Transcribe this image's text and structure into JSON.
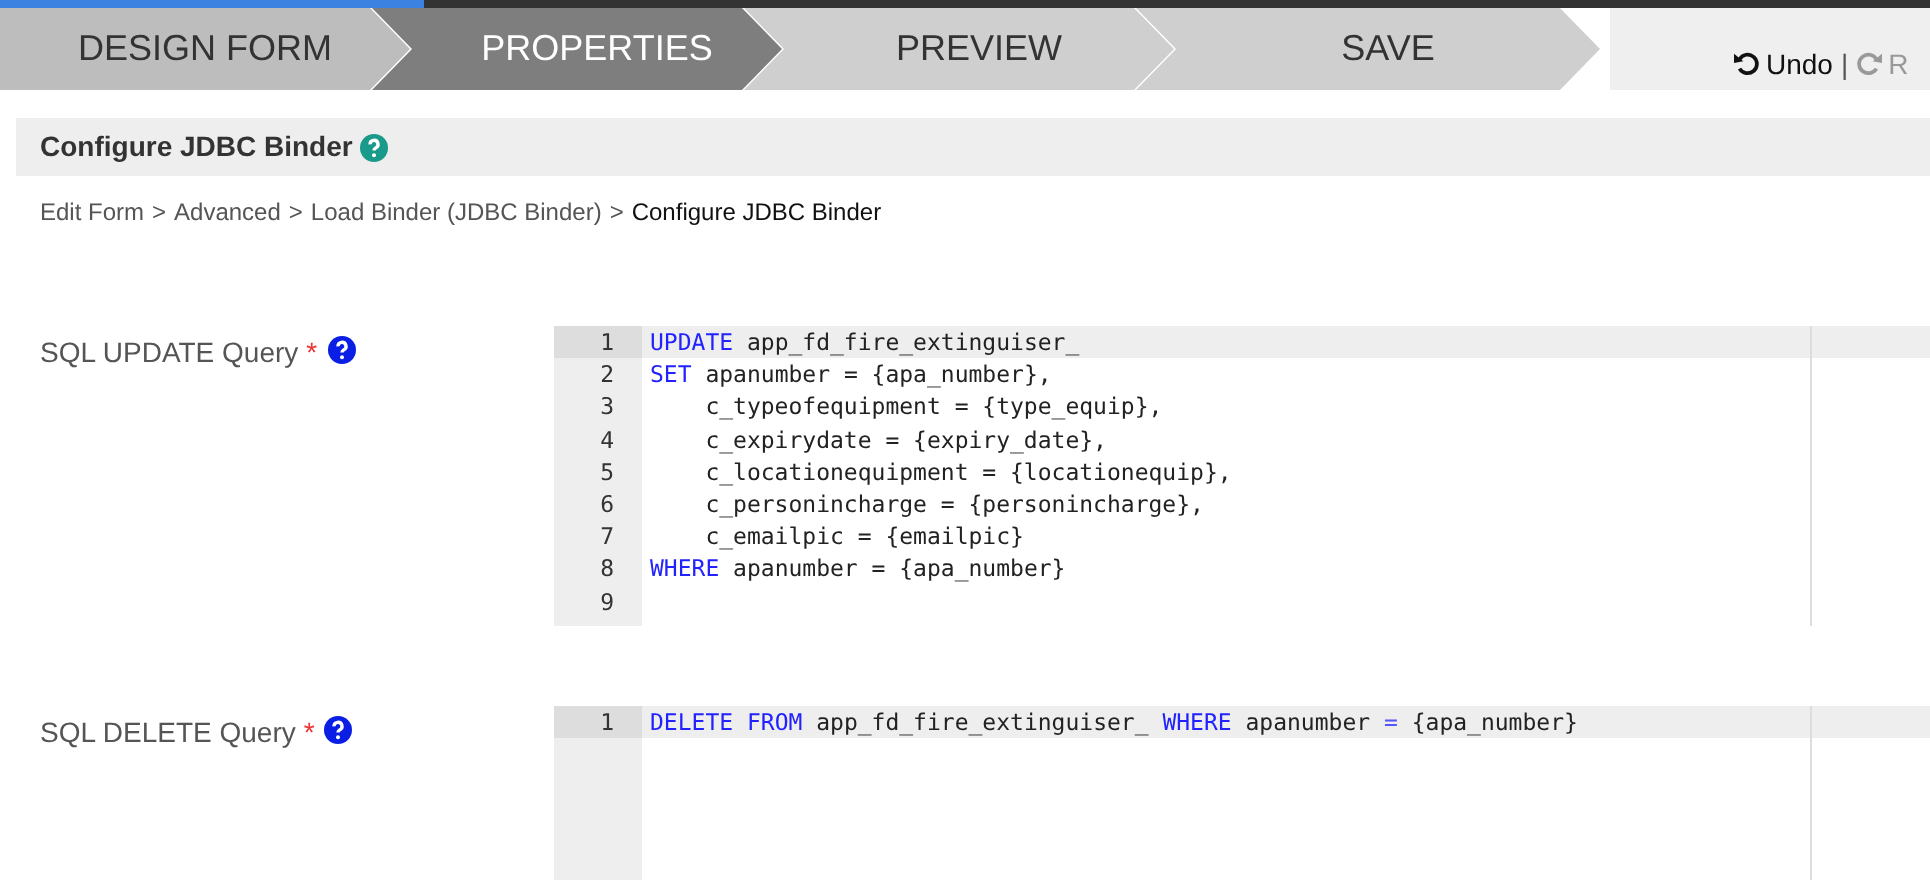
{
  "progress": {
    "level": 0.22
  },
  "steps": [
    {
      "label": "DESIGN FORM",
      "selected": false
    },
    {
      "label": "PROPERTIES",
      "selected": true
    },
    {
      "label": "PREVIEW",
      "selected": false
    },
    {
      "label": "SAVE",
      "selected": false
    }
  ],
  "history": [
    {
      "label": "Undo",
      "disabled": false,
      "kind": "undo"
    },
    {
      "label": "|",
      "kind": "separator"
    },
    {
      "label": "R",
      "disabled": true,
      "kind": "redo"
    }
  ],
  "panel": {
    "title": "Configure JDBC Binder"
  },
  "breadcrumb": [
    {
      "label": "Edit Form",
      "current": false,
      "separator": ">"
    },
    {
      "label": "Advanced",
      "current": false,
      "separator": ">"
    },
    {
      "label": "Load Binder (JDBC Binder)",
      "current": false,
      "separator": ">"
    },
    {
      "label": "Configure JDBC Binder",
      "current": true
    }
  ],
  "fields": [
    {
      "label": "SQL UPDATE Query",
      "required_mark": "*",
      "lines": [
        {
          "number": "1",
          "active": true,
          "tokens": [
            {
              "kind": "keyword",
              "text": "UPDATE"
            },
            {
              "kind": "plain",
              "text": " app_fd_fire_extinguiser_"
            }
          ]
        },
        {
          "number": "2",
          "active": false,
          "tokens": [
            {
              "kind": "keyword",
              "text": "SET"
            },
            {
              "kind": "plain",
              "text": " apanumber = {apa_number},"
            }
          ]
        },
        {
          "number": "3",
          "active": false,
          "tokens": [
            {
              "kind": "plain",
              "text": "    c_typeofequipment = {type_equip},"
            }
          ]
        },
        {
          "number": "4",
          "active": false,
          "tokens": [
            {
              "kind": "plain",
              "text": "    c_expirydate = {expiry_date},"
            }
          ]
        },
        {
          "number": "5",
          "active": false,
          "tokens": [
            {
              "kind": "plain",
              "text": "    c_locationequipment = {locationequip},"
            }
          ]
        },
        {
          "number": "6",
          "active": false,
          "tokens": [
            {
              "kind": "plain",
              "text": "    c_personincharge = {personincharge},"
            }
          ]
        },
        {
          "number": "7",
          "active": false,
          "tokens": [
            {
              "kind": "plain",
              "text": "    c_emailpic = {emailpic}"
            }
          ]
        },
        {
          "number": "8",
          "active": false,
          "tokens": [
            {
              "kind": "keyword",
              "text": "WHERE"
            },
            {
              "kind": "plain",
              "text": " apanumber = {apa_number}"
            }
          ]
        },
        {
          "number": "9",
          "active": false
        }
      ]
    },
    {
      "label": "SQL DELETE Query",
      "required_mark": "*",
      "lines": [
        {
          "number": "1",
          "active": true,
          "tokens": [
            {
              "kind": "keyword",
              "text": "DELETE"
            },
            {
              "kind": "keyword",
              "text": " FROM"
            },
            {
              "kind": "plain",
              "text": " app_fd_fire_extinguiser_ "
            },
            {
              "kind": "keyword",
              "text": "WHERE"
            },
            {
              "kind": "plain",
              "text": " apanumber "
            },
            {
              "kind": "operator",
              "text": "="
            },
            {
              "kind": "plain",
              "text": " {apa_number}"
            }
          ]
        }
      ]
    }
  ]
}
